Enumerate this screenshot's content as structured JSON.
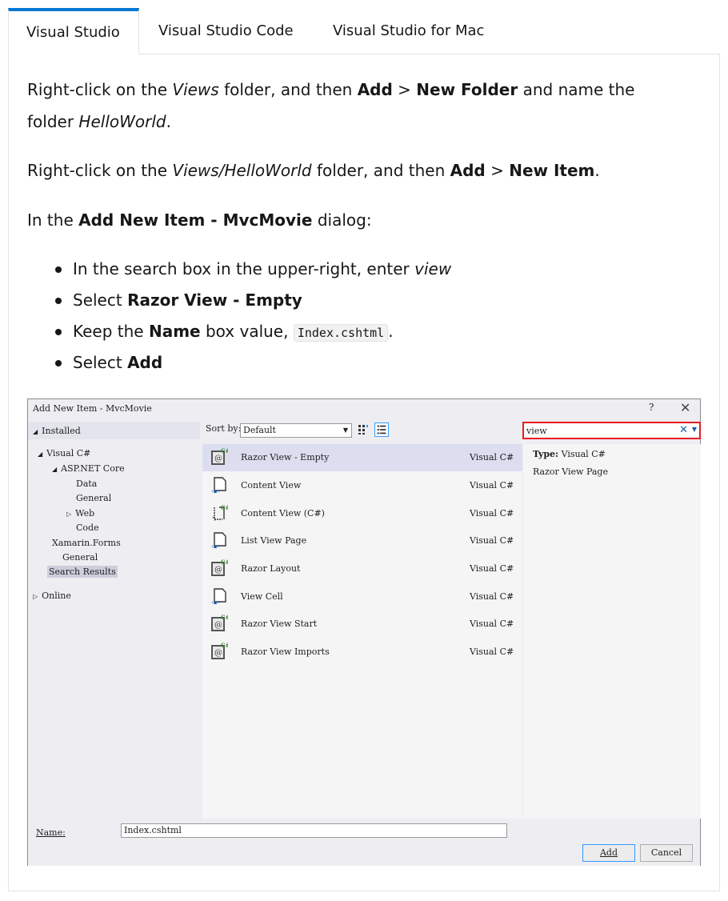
{
  "tabs": [
    {
      "label": "Visual Studio",
      "active": true
    },
    {
      "label": "Visual Studio Code",
      "active": false
    },
    {
      "label": "Visual Studio for Mac",
      "active": false
    }
  ],
  "instructions": {
    "p1": {
      "a": "Right-click on the ",
      "b": "Views",
      "c": " folder, and then ",
      "d": "Add",
      "e": " > ",
      "f": "New Folder",
      "g": " and name the",
      "h": "folder ",
      "i": "HelloWorld",
      "j": "."
    },
    "p2": {
      "a": "Right-click on the ",
      "b": "Views/HelloWorld",
      "c": " folder, and then ",
      "d": "Add",
      "e": " > ",
      "f": "New Item",
      "g": "."
    },
    "p3": {
      "a": "In the ",
      "b": "Add New Item - MvcMovie",
      "c": " dialog:"
    },
    "steps": [
      {
        "a": "In the search box in the upper-right, enter ",
        "b": "view"
      },
      {
        "a": "Select ",
        "b": "Razor View - Empty"
      },
      {
        "a": "Keep the ",
        "b": "Name",
        "c": " box value, ",
        "code": "Index.cshtml",
        "d": "."
      },
      {
        "a": "Select ",
        "b": "Add"
      }
    ]
  },
  "dialog": {
    "title": "Add New Item - MvcMovie",
    "help": "?",
    "close": "✕",
    "installed": "Installed",
    "tree": {
      "visual_csharp": "Visual C#",
      "aspnet_core": "ASP.NET Core",
      "data": "Data",
      "general_sub": "General",
      "web": "Web",
      "code": "Code",
      "xamarin": "Xamarin.Forms",
      "general": "General",
      "search_results": "Search Results",
      "online": "Online"
    },
    "sort_label": "Sort by:",
    "sort_value": "Default",
    "search_value": "view",
    "items": [
      {
        "name": "Razor View - Empty",
        "type": "Visual C#",
        "icon": "razor-icon",
        "selected": true
      },
      {
        "name": "Content View",
        "type": "Visual C#",
        "icon": "xaml-page-icon",
        "selected": false
      },
      {
        "name": "Content View (C#)",
        "type": "Visual C#",
        "icon": "csharp-view-icon",
        "selected": false
      },
      {
        "name": "List View Page",
        "type": "Visual C#",
        "icon": "xaml-page-icon",
        "selected": false
      },
      {
        "name": "Razor Layout",
        "type": "Visual C#",
        "icon": "razor-icon",
        "selected": false
      },
      {
        "name": "View Cell",
        "type": "Visual C#",
        "icon": "xaml-page-icon",
        "selected": false
      },
      {
        "name": "Razor View Start",
        "type": "Visual C#",
        "icon": "razor-icon",
        "selected": false
      },
      {
        "name": "Razor View Imports",
        "type": "Visual C#",
        "icon": "razor-icon",
        "selected": false
      }
    ],
    "details": {
      "type_label": "Type:",
      "type_value": "Visual C#",
      "description": "Razor View Page"
    },
    "name_label": "Name:",
    "name_value": "Index.cshtml",
    "add_button": "Add",
    "cancel_button": "Cancel"
  }
}
